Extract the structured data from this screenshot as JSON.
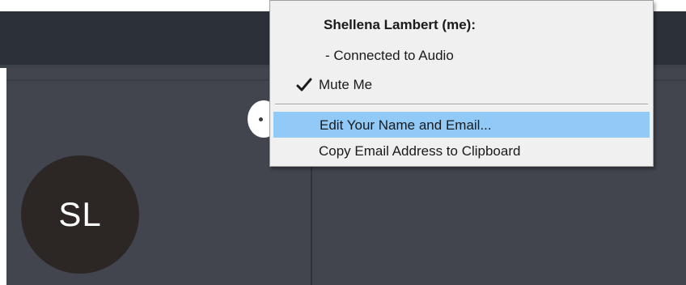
{
  "participant": {
    "initials": "SL"
  },
  "context_menu": {
    "header": "Shellena Lambert (me):",
    "audio_status": "- Connected to Audio",
    "mute_label": "Mute Me",
    "mute_checked": true,
    "edit_label": "Edit Your Name and Email...",
    "copy_label": "Copy Email Address to Clipboard",
    "highlight_color": "#91c9f7"
  },
  "icons": {
    "mute_check": "checkmark-icon",
    "more": "more-options-icon"
  },
  "colors": {
    "title_bar": "#2c3039",
    "content_bg": "#42454e",
    "avatar_bg": "#2c2725"
  }
}
